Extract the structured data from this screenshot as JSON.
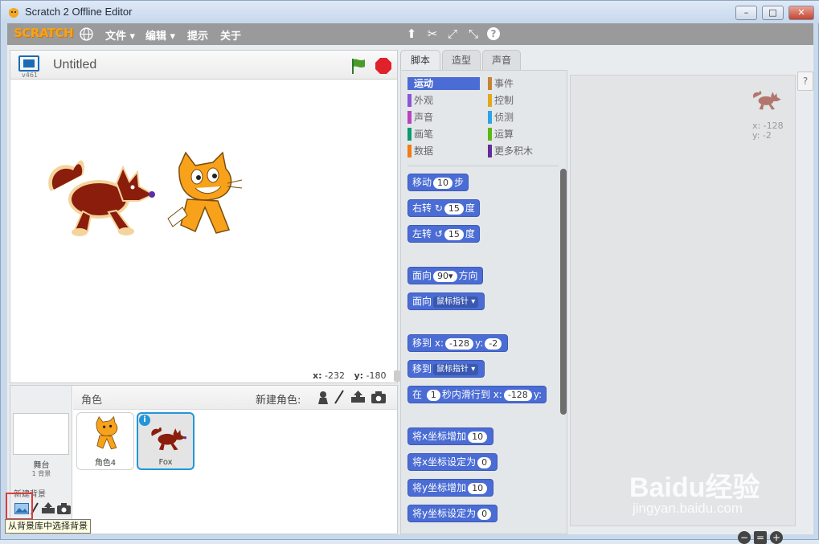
{
  "window": {
    "title": "Scratch 2 Offline Editor",
    "minimize": "–",
    "maximize": "□",
    "close": "✕"
  },
  "menubar": {
    "logo": "SCRATCH",
    "items": [
      {
        "label": "文件 ▾"
      },
      {
        "label": "编辑 ▾"
      },
      {
        "label": "提示"
      },
      {
        "label": "关于"
      }
    ],
    "tools": [
      {
        "icon": "duplicate-stamp-icon",
        "glyph": "⬆"
      },
      {
        "icon": "cut-icon",
        "glyph": "✂"
      },
      {
        "icon": "grow-icon",
        "glyph": "⤢"
      },
      {
        "icon": "shrink-icon",
        "glyph": "⤡"
      },
      {
        "icon": "help-icon",
        "glyph": "?"
      }
    ]
  },
  "stage": {
    "version": "v461",
    "project_title": "Untitled",
    "coords": {
      "x_label": "x:",
      "x": "-232",
      "y_label": "y:",
      "y": "-180"
    }
  },
  "sprites": {
    "header": "角色",
    "new_sprite_label": "新建角色:",
    "stage_label": "舞台",
    "stage_sub": "1 背景",
    "new_backdrop_label": "新建背景",
    "items": [
      {
        "name": "角色4",
        "selected": false
      },
      {
        "name": "Fox",
        "selected": true
      }
    ]
  },
  "tabs": [
    {
      "label": "脚本",
      "active": true
    },
    {
      "label": "造型",
      "active": false
    },
    {
      "label": "声音",
      "active": false
    }
  ],
  "categories": [
    {
      "label": "运动",
      "color": "#4a6cd4",
      "active": true
    },
    {
      "label": "事件",
      "color": "#c88330",
      "active": false
    },
    {
      "label": "外观",
      "color": "#8a55d7",
      "active": false
    },
    {
      "label": "控制",
      "color": "#e1a91a",
      "active": false
    },
    {
      "label": "声音",
      "color": "#bb42c3",
      "active": false
    },
    {
      "label": "侦测",
      "color": "#2ca5e2",
      "active": false
    },
    {
      "label": "画笔",
      "color": "#0e9a6c",
      "active": false
    },
    {
      "label": "运算",
      "color": "#5cb712",
      "active": false
    },
    {
      "label": "数据",
      "color": "#ee7d16",
      "active": false
    },
    {
      "label": "更多积木",
      "color": "#632d99",
      "active": false
    }
  ],
  "blocks": {
    "move": {
      "a": "移动",
      "v": "10",
      "b": "步"
    },
    "turn_right": {
      "a": "右转",
      "v": "15",
      "b": "度"
    },
    "turn_left": {
      "a": "左转",
      "v": "15",
      "b": "度"
    },
    "point_dir": {
      "a": "面向",
      "v": "90▾",
      "b": "方向"
    },
    "point_towards": {
      "a": "面向",
      "v": "鼠标指针 ▾"
    },
    "goto_xy": {
      "a": "移到",
      "x": "x:",
      "xv": "-128",
      "y": "y:",
      "yv": "-2"
    },
    "goto": {
      "a": "移到",
      "v": "鼠标指针 ▾"
    },
    "glide": {
      "a": "在",
      "secs": "1",
      "b": "秒内滑行到",
      "x": "x:",
      "xv": "-128",
      "y": "y:"
    },
    "change_x": {
      "a": "将x坐标增加",
      "v": "10"
    },
    "set_x": {
      "a": "将x坐标设定为",
      "v": "0"
    },
    "change_y": {
      "a": "将y坐标增加",
      "v": "10"
    },
    "set_y": {
      "a": "将y坐标设定为",
      "v": "0"
    }
  },
  "script_area": {
    "x_label": "x:",
    "x": "-128",
    "y_label": "y:",
    "y": "-2"
  },
  "tooltip": "从背景库中选择背景",
  "watermark": {
    "brand": "Baidu经验",
    "url": "jingyan.baidu.com"
  }
}
